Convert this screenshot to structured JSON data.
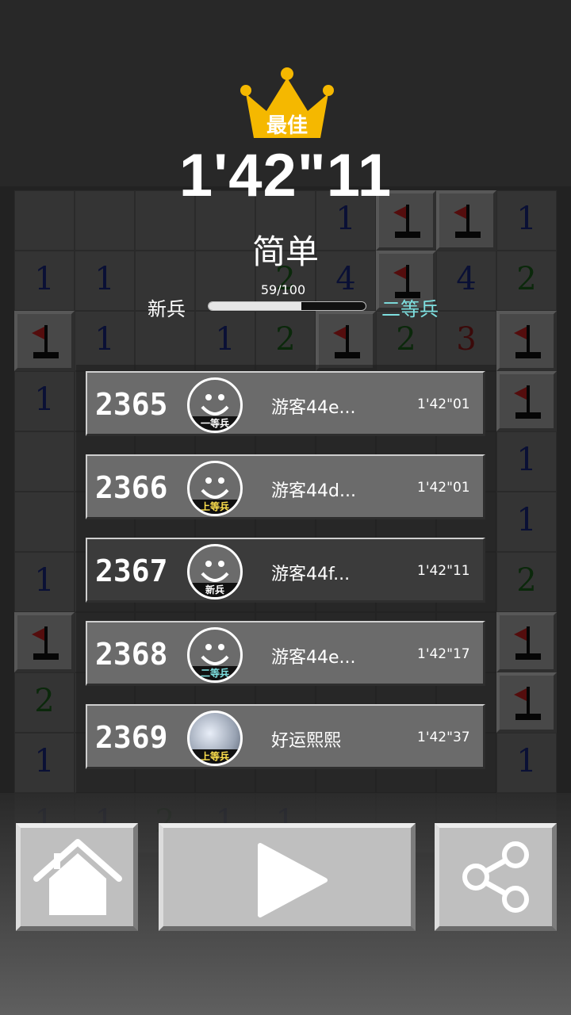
{
  "header": {
    "best_label": "最佳",
    "best_time": "1'42\"11",
    "difficulty": "简单",
    "progress_text": "59/100",
    "progress_fraction": 0.59,
    "rank_current": "新兵",
    "rank_next": "二等兵"
  },
  "leaderboard": [
    {
      "rank": "2365",
      "badge": "一等兵",
      "badge_color": "#ffffff",
      "name": "游客44e...",
      "time": "1'42\"01",
      "avatar": "smiley-icon",
      "highlight": false
    },
    {
      "rank": "2366",
      "badge": "上等兵",
      "badge_color": "#ffe14d",
      "name": "游客44d...",
      "time": "1'42\"01",
      "avatar": "smiley-icon",
      "highlight": false
    },
    {
      "rank": "2367",
      "badge": "新兵",
      "badge_color": "#ffffff",
      "name": "游客44f...",
      "time": "1'42\"11",
      "avatar": "smiley-icon",
      "highlight": true
    },
    {
      "rank": "2368",
      "badge": "二等兵",
      "badge_color": "#7ee0e0",
      "name": "游客44e...",
      "time": "1'42\"17",
      "avatar": "smiley-icon",
      "highlight": false
    },
    {
      "rank": "2369",
      "badge": "上等兵",
      "badge_color": "#ffe14d",
      "name": "好运熙熙",
      "time": "1'42\"37",
      "avatar": "photo-avatar",
      "highlight": false
    }
  ],
  "buttons": {
    "home": "home-icon",
    "play": "play-icon",
    "share": "share-icon"
  },
  "colors": {
    "crown": "#f5b800",
    "rank_next": "#7ee0e0",
    "number_1": "#1c2a8c",
    "number_2": "#1d6b1d",
    "number_3": "#9b1b1b",
    "number_4": "#1c2a8c"
  }
}
